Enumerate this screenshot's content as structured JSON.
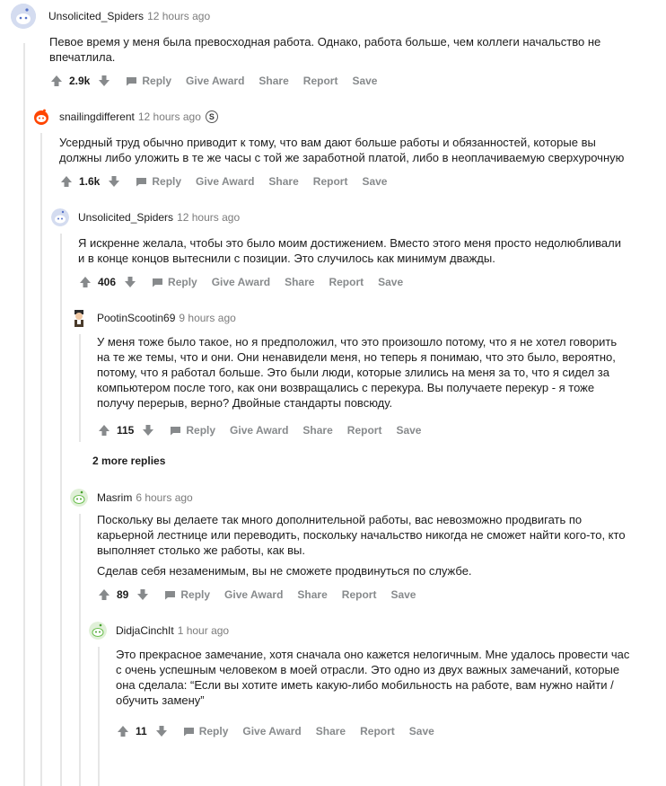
{
  "actions": {
    "reply": "Reply",
    "give_award": "Give Award",
    "share": "Share",
    "report": "Report",
    "save": "Save"
  },
  "comments": [
    {
      "author": "Unsolicited_Spiders",
      "time": "12 hours ago",
      "paragraphs": [
        "Певое время у меня была превосходная работа. Однако, работа больше, чем коллеги начальство не впечатлила."
      ],
      "score": "2.9k",
      "avatar_icon": "snoo-avatar-icon"
    },
    {
      "author": "snailingdifferent",
      "time": "12 hours ago",
      "badge": "S",
      "paragraphs": [
        "Усердный труд обычно приводит к тому, что вам дают больше работы и обязанностей, которые вы должны либо уложить в те же часы с той же заработной платой, либо в неоплачиваемую сверхурочную"
      ],
      "score": "1.6k",
      "avatar_icon": "red-snoo-avatar-icon"
    },
    {
      "author": "Unsolicited_Spiders",
      "time": "12 hours ago",
      "paragraphs": [
        "Я искренне желала, чтобы это было моим достижением. Вместо этого меня просто недолюбливали и в конце концов вытеснили с позиции. Это случилось как минимум дважды."
      ],
      "score": "406",
      "avatar_icon": "snoo-avatar-icon"
    },
    {
      "author": "PootinScootin69",
      "time": "9 hours ago",
      "paragraphs": [
        "У меня тоже было такое, но я предположил, что это произошло потому, что я не хотел говорить на те же темы, что и они. Они ненавидели меня, но теперь я понимаю, что это было, вероятно, потому, что я работал больше. Это были люди, которые злились на меня за то, что я сидел за компьютером после того, как они возвращались с перекура. Вы получаете перекур - я тоже получу перерыв, верно? Двойные стандарты повсюду."
      ],
      "score": "115",
      "avatar_icon": "character-avatar-icon"
    },
    {
      "author": "Masrim",
      "time": "6 hours ago",
      "paragraphs": [
        "Поскольку вы делаете так много дополнительной работы, вас невозможно продвигать по карьерной лестнице или переводить, поскольку начальство никогда не сможет найти кого-то, кто выполняет столько же работы, как вы.",
        "Сделав себя незаменимым, вы не сможете продвинуться по службе."
      ],
      "score": "89",
      "avatar_icon": "green-snoo-avatar-icon"
    },
    {
      "author": "DidjaCinchIt",
      "time": "1 hour ago",
      "paragraphs": [
        "Это прекрасное замечание, хотя сначала оно кажется нелогичным. Мне удалось провести час с очень успешным человеком в моей отрасли. Это одно из двух важных замечаний, которые она сделала: “Если вы хотите иметь какую-либо мобильность на работе, вам нужно найти / обучить замену”"
      ],
      "score": "11",
      "avatar_icon": "green-snoo-avatar-icon"
    }
  ],
  "more_replies": "2 more replies",
  "colors": {
    "upvote": "#878a8c",
    "thread_line": "#e6e6e6",
    "text": "#1c1c1c",
    "meta": "#7c7c7c"
  }
}
